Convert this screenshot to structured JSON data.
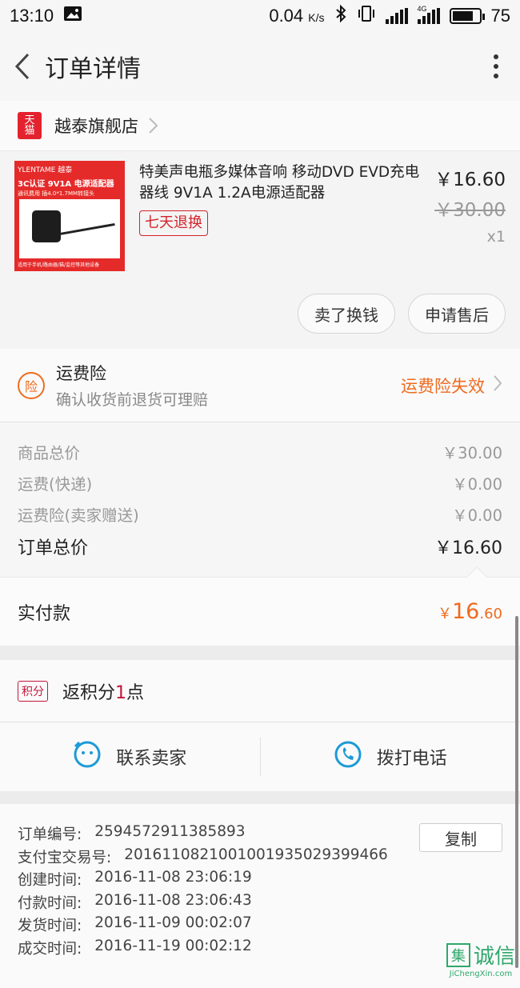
{
  "status_bar": {
    "time": "13:10",
    "speed": "0.04",
    "speed_unit": "K/s",
    "network": "4G",
    "battery": "75"
  },
  "nav": {
    "title": "订单详情"
  },
  "shop": {
    "badge": "天猫",
    "name": "越泰旗舰店"
  },
  "product": {
    "image": {
      "brand": "YLENTAME 越泰",
      "headline": "3C认证 9V1A 电源适配器",
      "subline": "通讯费用 插4.0*1.7MM转接头",
      "footer": "适用于手机/路由器/猫/监控等其他设备"
    },
    "title": "特美声电瓶多媒体音响 移动DVD EVD充电器线 9V1A 1.2A电源适配器",
    "badge": "七天退换",
    "price_now": "￥16.60",
    "price_old": "￥30.00",
    "qty": "x1",
    "buttons": [
      "卖了换钱",
      "申请售后"
    ]
  },
  "insurance": {
    "icon": "险",
    "title": "运费险",
    "subtitle": "确认收货前退货可理赔",
    "status": "运费险失效"
  },
  "costs": {
    "rows": [
      {
        "label": "商品总价",
        "value": "￥30.00"
      },
      {
        "label": "运费(快递)",
        "value": "￥0.00"
      },
      {
        "label": "运费险(卖家赠送)",
        "value": "￥0.00"
      }
    ],
    "total_label": "订单总价",
    "total_value": "￥16.60"
  },
  "payment": {
    "label": "实付款",
    "currency": "￥",
    "amount_int": "16",
    "amount_dec": ".60"
  },
  "points": {
    "badge": "积分",
    "text_before": "返积分",
    "number": "1",
    "text_after": "点"
  },
  "contact": {
    "seller": "联系卖家",
    "phone": "拨打电话"
  },
  "order_info": {
    "copy": "复制",
    "rows": [
      {
        "label": "订单编号:",
        "value": "2594572911385893"
      },
      {
        "label": "支付宝交易号:",
        "value": "2016110821001001935029399466"
      },
      {
        "label": "创建时间:",
        "value": "2016-11-08 23:06:19"
      },
      {
        "label": "付款时间:",
        "value": "2016-11-08 23:06:43"
      },
      {
        "label": "发货时间:",
        "value": "2016-11-09 00:02:07"
      },
      {
        "label": "成交时间:",
        "value": "2016-11-19 00:02:12"
      }
    ]
  },
  "watermark": {
    "logo": "集",
    "text": "诚信",
    "url": "JiChengXin.com"
  },
  "colors": {
    "accent_orange": "#ef6b1f",
    "tmall_red": "#e4222e",
    "points_red": "#c4173b",
    "contact_blue": "#1e9ad6"
  }
}
